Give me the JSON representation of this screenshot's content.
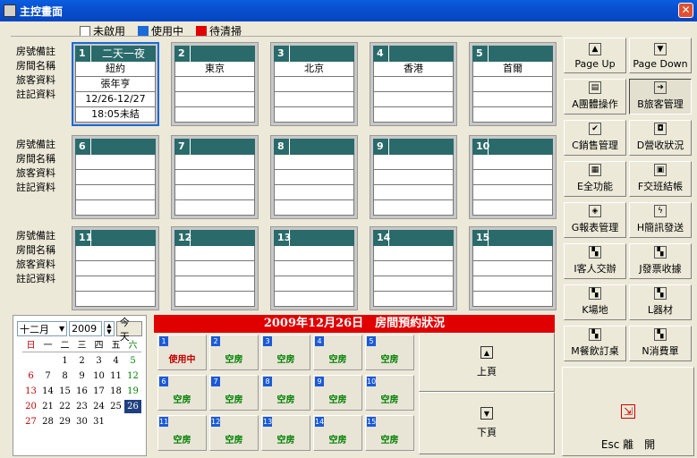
{
  "window": {
    "title": "主控畫面",
    "close_glyph": "✕"
  },
  "legend": [
    {
      "label": "未啟用",
      "color": "#ffffff"
    },
    {
      "label": "使用中",
      "color": "#1a6ad8"
    },
    {
      "label": "待清掃",
      "color": "#e00000"
    }
  ],
  "row_labels": [
    "房號備註",
    "房間名稱",
    "旅客資料",
    "註記資料"
  ],
  "rooms": [
    {
      "num": "1",
      "head": "二天一夜",
      "lines": [
        "紐約",
        "張年亨",
        "12/26-12/27",
        "18:05未結"
      ]
    },
    {
      "num": "2",
      "head": "",
      "lines": [
        "東京",
        "",
        "",
        ""
      ]
    },
    {
      "num": "3",
      "head": "",
      "lines": [
        "北京",
        "",
        "",
        ""
      ]
    },
    {
      "num": "4",
      "head": "",
      "lines": [
        "香港",
        "",
        "",
        ""
      ]
    },
    {
      "num": "5",
      "head": "",
      "lines": [
        "首爾",
        "",
        "",
        ""
      ]
    },
    {
      "num": "6",
      "head": "",
      "lines": [
        "",
        "",
        "",
        ""
      ]
    },
    {
      "num": "7",
      "head": "",
      "lines": [
        "",
        "",
        "",
        ""
      ]
    },
    {
      "num": "8",
      "head": "",
      "lines": [
        "",
        "",
        "",
        ""
      ]
    },
    {
      "num": "9",
      "head": "",
      "lines": [
        "",
        "",
        "",
        ""
      ]
    },
    {
      "num": "10",
      "head": "",
      "lines": [
        "",
        "",
        "",
        ""
      ]
    },
    {
      "num": "11",
      "head": "",
      "lines": [
        "",
        "",
        "",
        ""
      ]
    },
    {
      "num": "12",
      "head": "",
      "lines": [
        "",
        "",
        "",
        ""
      ]
    },
    {
      "num": "13",
      "head": "",
      "lines": [
        "",
        "",
        "",
        ""
      ]
    },
    {
      "num": "14",
      "head": "",
      "lines": [
        "",
        "",
        "",
        ""
      ]
    },
    {
      "num": "15",
      "head": "",
      "lines": [
        "",
        "",
        "",
        ""
      ]
    }
  ],
  "buttons": [
    {
      "label": "Page Up",
      "icon": "arrow-up-icon",
      "glyph": "▲"
    },
    {
      "label": "Page Down",
      "icon": "arrow-down-icon",
      "glyph": "▼"
    },
    {
      "label": "A團體操作",
      "icon": "group-icon",
      "glyph": "▤"
    },
    {
      "label": "B旅客管理",
      "icon": "guest-icon",
      "glyph": "➔"
    },
    {
      "label": "C銷售管理",
      "icon": "sales-icon",
      "glyph": "✔"
    },
    {
      "label": "D營收狀況",
      "icon": "revenue-icon",
      "glyph": "◘"
    },
    {
      "label": "E全功能",
      "icon": "all-functions-icon",
      "glyph": "▦"
    },
    {
      "label": "F交班結帳",
      "icon": "checkout-icon",
      "glyph": "▣"
    },
    {
      "label": "G報表管理",
      "icon": "report-icon",
      "glyph": "◈"
    },
    {
      "label": "H簡訊發送",
      "icon": "sms-icon",
      "glyph": "ϟ"
    },
    {
      "label": "I客人交辦",
      "icon": "task-icon",
      "glyph": "▚"
    },
    {
      "label": "J發票收據",
      "icon": "invoice-icon",
      "glyph": "▚"
    },
    {
      "label": "K場地",
      "icon": "venue-icon",
      "glyph": "▚"
    },
    {
      "label": "L器材",
      "icon": "equipment-icon",
      "glyph": "▚"
    },
    {
      "label": "M餐飲訂桌",
      "icon": "dining-icon",
      "glyph": "▚"
    },
    {
      "label": "N消費單",
      "icon": "bill-icon",
      "glyph": "▚"
    }
  ],
  "exit_button": {
    "label": "Esc 離　開",
    "icon": "exit-icon",
    "glyph": "⇲"
  },
  "calendar": {
    "month": "十二月",
    "year": "2009",
    "today_label": "今天",
    "weekdays": [
      "日",
      "一",
      "二",
      "三",
      "四",
      "五",
      "六"
    ],
    "weeks": [
      [
        "",
        "",
        "1",
        "2",
        "3",
        "4",
        "5"
      ],
      [
        "6",
        "7",
        "8",
        "9",
        "10",
        "11",
        "12"
      ],
      [
        "13",
        "14",
        "15",
        "16",
        "17",
        "18",
        "19"
      ],
      [
        "20",
        "21",
        "22",
        "23",
        "24",
        "25",
        "26"
      ],
      [
        "27",
        "28",
        "29",
        "30",
        "31",
        "",
        ""
      ]
    ],
    "selected": "26"
  },
  "reservation": {
    "title": "2009年12月26日　房間預約狀況",
    "cells": [
      {
        "num": "1",
        "status": "使用中",
        "kind": "inuse"
      },
      {
        "num": "2",
        "status": "空房",
        "kind": "empty"
      },
      {
        "num": "3",
        "status": "空房",
        "kind": "empty"
      },
      {
        "num": "4",
        "status": "空房",
        "kind": "empty"
      },
      {
        "num": "5",
        "status": "空房",
        "kind": "empty"
      },
      {
        "num": "6",
        "status": "空房",
        "kind": "empty"
      },
      {
        "num": "7",
        "status": "空房",
        "kind": "empty"
      },
      {
        "num": "8",
        "status": "空房",
        "kind": "empty"
      },
      {
        "num": "9",
        "status": "空房",
        "kind": "empty"
      },
      {
        "num": "10",
        "status": "空房",
        "kind": "empty"
      },
      {
        "num": "11",
        "status": "空房",
        "kind": "empty"
      },
      {
        "num": "12",
        "status": "空房",
        "kind": "empty"
      },
      {
        "num": "13",
        "status": "空房",
        "kind": "empty"
      },
      {
        "num": "14",
        "status": "空房",
        "kind": "empty"
      },
      {
        "num": "15",
        "status": "空房",
        "kind": "empty"
      }
    ],
    "prev_label": "上頁",
    "next_label": "下頁"
  }
}
